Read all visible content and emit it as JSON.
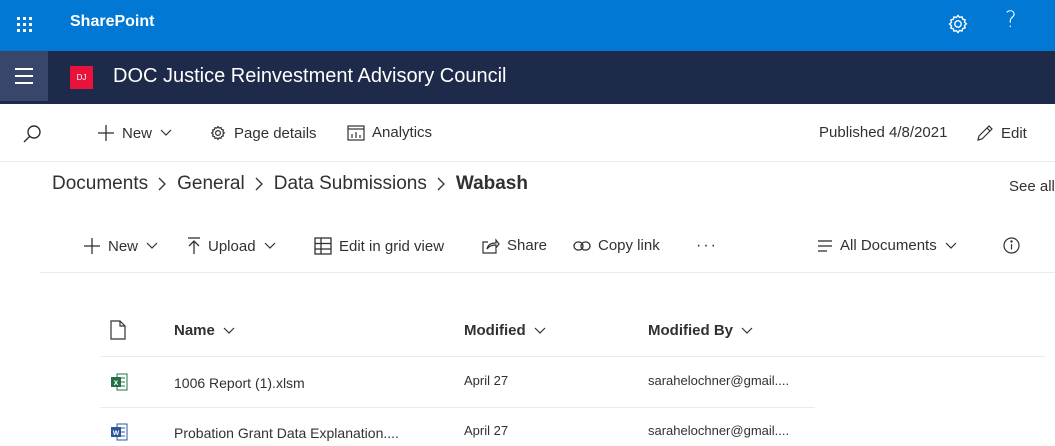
{
  "suite": {
    "app_name": "SharePoint"
  },
  "site": {
    "logo_text": "DJ",
    "title": "DOC Justice Reinvestment Advisory Council"
  },
  "page_commands": {
    "new_label": "New",
    "details_label": "Page details",
    "analytics_label": "Analytics",
    "published_label": "Published 4/8/2021",
    "edit_label": "Edit"
  },
  "breadcrumb": {
    "items": [
      "Documents",
      "General",
      "Data Submissions"
    ],
    "current": "Wabash",
    "see_all": "See all"
  },
  "library_commands": {
    "new_label": "New",
    "upload_label": "Upload",
    "grid_label": "Edit in grid view",
    "share_label": "Share",
    "copy_label": "Copy link",
    "more_label": "···",
    "view_label": "All Documents"
  },
  "columns": {
    "name": "Name",
    "modified": "Modified",
    "modified_by": "Modified By"
  },
  "files": [
    {
      "icon": "excel-icon",
      "name": "1006 Report (1).xlsm",
      "modified": "April 27",
      "modified_by": "sarahelochner@gmail...."
    },
    {
      "icon": "word-icon",
      "name": "Probation Grant Data Explanation....",
      "modified": "April 27",
      "modified_by": "sarahelochner@gmail...."
    }
  ],
  "colors": {
    "suite_bar": "#0078d4",
    "site_header": "#1e2a4a",
    "logo": "#e8133c",
    "excel": "#217346",
    "word": "#2b579a"
  }
}
